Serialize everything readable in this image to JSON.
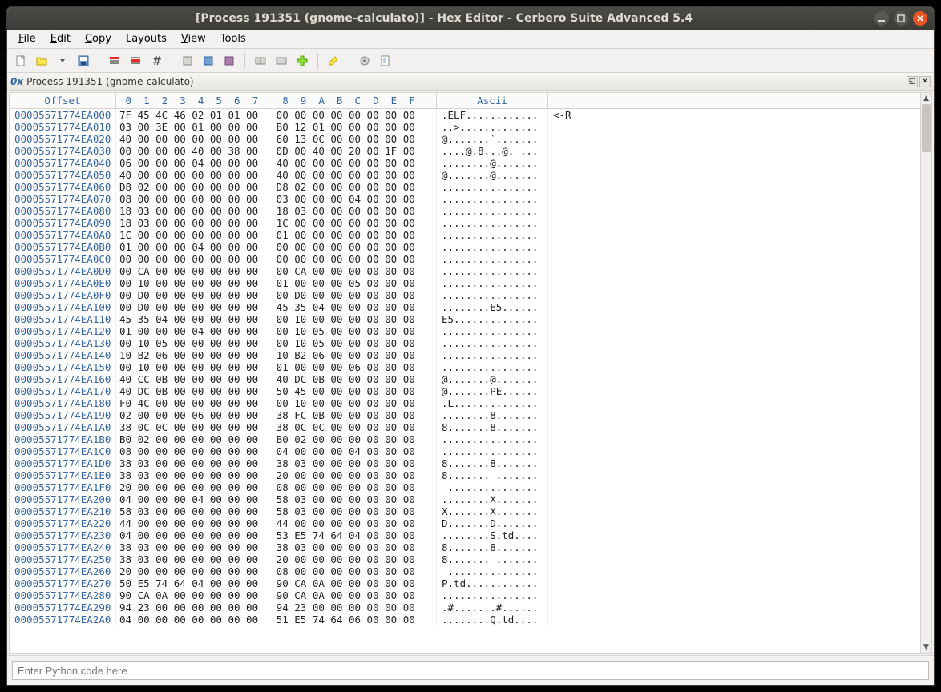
{
  "window": {
    "title": "[Process 191351 (gnome-calculato)] - Hex Editor - Cerbero Suite Advanced 5.4"
  },
  "menu": {
    "file": "File",
    "edit": "Edit",
    "copy": "Copy",
    "layouts": "Layouts",
    "view": "View",
    "tools": "Tools"
  },
  "breadcrumb": {
    "prefix": "0x",
    "text": "Process 191351 (gnome-calculato)"
  },
  "hex_header": {
    "offset": "Offset",
    "cols": " 0  1  2  3  4  5  6  7    8  9  A  B  C  D  E  F",
    "ascii": "Ascii"
  },
  "hint": "<-R",
  "rows": [
    {
      "o": "00005571774EA000",
      "h": "7F 45 4C 46 02 01 01 00   00 00 00 00 00 00 00 00",
      "a": ".ELF............"
    },
    {
      "o": "00005571774EA010",
      "h": "03 00 3E 00 01 00 00 00   B0 12 01 00 00 00 00 00",
      "a": "..>............."
    },
    {
      "o": "00005571774EA020",
      "h": "40 00 00 00 00 00 00 00   60 13 0C 00 00 00 00 00",
      "a": "@.......`......."
    },
    {
      "o": "00005571774EA030",
      "h": "00 00 00 00 40 00 38 00   0D 00 40 00 20 00 1F 00",
      "a": "....@.8...@. ..."
    },
    {
      "o": "00005571774EA040",
      "h": "06 00 00 00 04 00 00 00   40 00 00 00 00 00 00 00",
      "a": "........@......."
    },
    {
      "o": "00005571774EA050",
      "h": "40 00 00 00 00 00 00 00   40 00 00 00 00 00 00 00",
      "a": "@.......@......."
    },
    {
      "o": "00005571774EA060",
      "h": "D8 02 00 00 00 00 00 00   D8 02 00 00 00 00 00 00",
      "a": "................"
    },
    {
      "o": "00005571774EA070",
      "h": "08 00 00 00 00 00 00 00   03 00 00 00 04 00 00 00",
      "a": "................"
    },
    {
      "o": "00005571774EA080",
      "h": "18 03 00 00 00 00 00 00   18 03 00 00 00 00 00 00",
      "a": "................"
    },
    {
      "o": "00005571774EA090",
      "h": "18 03 00 00 00 00 00 00   1C 00 00 00 00 00 00 00",
      "a": "................"
    },
    {
      "o": "00005571774EA0A0",
      "h": "1C 00 00 00 00 00 00 00   01 00 00 00 00 00 00 00",
      "a": "................"
    },
    {
      "o": "00005571774EA0B0",
      "h": "01 00 00 00 04 00 00 00   00 00 00 00 00 00 00 00",
      "a": "................"
    },
    {
      "o": "00005571774EA0C0",
      "h": "00 00 00 00 00 00 00 00   00 00 00 00 00 00 00 00",
      "a": "................"
    },
    {
      "o": "00005571774EA0D0",
      "h": "00 CA 00 00 00 00 00 00   00 CA 00 00 00 00 00 00",
      "a": "................"
    },
    {
      "o": "00005571774EA0E0",
      "h": "00 10 00 00 00 00 00 00   01 00 00 00 05 00 00 00",
      "a": "................"
    },
    {
      "o": "00005571774EA0F0",
      "h": "00 D0 00 00 00 00 00 00   00 D0 00 00 00 00 00 00",
      "a": "................"
    },
    {
      "o": "00005571774EA100",
      "h": "00 D0 00 00 00 00 00 00   45 35 04 00 00 00 00 00",
      "a": "........E5......"
    },
    {
      "o": "00005571774EA110",
      "h": "45 35 04 00 00 00 00 00   00 10 00 00 00 00 00 00",
      "a": "E5.............."
    },
    {
      "o": "00005571774EA120",
      "h": "01 00 00 00 04 00 00 00   00 10 05 00 00 00 00 00",
      "a": "................"
    },
    {
      "o": "00005571774EA130",
      "h": "00 10 05 00 00 00 00 00   00 10 05 00 00 00 00 00",
      "a": "................"
    },
    {
      "o": "00005571774EA140",
      "h": "10 B2 06 00 00 00 00 00   10 B2 06 00 00 00 00 00",
      "a": "................"
    },
    {
      "o": "00005571774EA150",
      "h": "00 10 00 00 00 00 00 00   01 00 00 00 06 00 00 00",
      "a": "................"
    },
    {
      "o": "00005571774EA160",
      "h": "40 CC 0B 00 00 00 00 00   40 DC 0B 00 00 00 00 00",
      "a": "@.......@......."
    },
    {
      "o": "00005571774EA170",
      "h": "40 DC 0B 00 00 00 00 00   50 45 00 00 00 00 00 00",
      "a": "@.......PE......"
    },
    {
      "o": "00005571774EA180",
      "h": "F0 4C 00 00 00 00 00 00   00 10 00 00 00 00 00 00",
      "a": ".L.............."
    },
    {
      "o": "00005571774EA190",
      "h": "02 00 00 00 06 00 00 00   38 FC 0B 00 00 00 00 00",
      "a": "........8......."
    },
    {
      "o": "00005571774EA1A0",
      "h": "38 0C 0C 00 00 00 00 00   38 0C 0C 00 00 00 00 00",
      "a": "8.......8......."
    },
    {
      "o": "00005571774EA1B0",
      "h": "B0 02 00 00 00 00 00 00   B0 02 00 00 00 00 00 00",
      "a": "................"
    },
    {
      "o": "00005571774EA1C0",
      "h": "08 00 00 00 00 00 00 00   04 00 00 00 04 00 00 00",
      "a": "................"
    },
    {
      "o": "00005571774EA1D0",
      "h": "38 03 00 00 00 00 00 00   38 03 00 00 00 00 00 00",
      "a": "8.......8......."
    },
    {
      "o": "00005571774EA1E0",
      "h": "38 03 00 00 00 00 00 00   20 00 00 00 00 00 00 00",
      "a": "8....... ......."
    },
    {
      "o": "00005571774EA1F0",
      "h": "20 00 00 00 00 00 00 00   08 00 00 00 00 00 00 00",
      "a": " ..............."
    },
    {
      "o": "00005571774EA200",
      "h": "04 00 00 00 04 00 00 00   58 03 00 00 00 00 00 00",
      "a": "........X......."
    },
    {
      "o": "00005571774EA210",
      "h": "58 03 00 00 00 00 00 00   58 03 00 00 00 00 00 00",
      "a": "X.......X......."
    },
    {
      "o": "00005571774EA220",
      "h": "44 00 00 00 00 00 00 00   44 00 00 00 00 00 00 00",
      "a": "D.......D......."
    },
    {
      "o": "00005571774EA230",
      "h": "04 00 00 00 00 00 00 00   53 E5 74 64 04 00 00 00",
      "a": "........S.td...."
    },
    {
      "o": "00005571774EA240",
      "h": "38 03 00 00 00 00 00 00   38 03 00 00 00 00 00 00",
      "a": "8.......8......."
    },
    {
      "o": "00005571774EA250",
      "h": "38 03 00 00 00 00 00 00   20 00 00 00 00 00 00 00",
      "a": "8....... ......."
    },
    {
      "o": "00005571774EA260",
      "h": "20 00 00 00 00 00 00 00   08 00 00 00 00 00 00 00",
      "a": " ..............."
    },
    {
      "o": "00005571774EA270",
      "h": "50 E5 74 64 04 00 00 00   90 CA 0A 00 00 00 00 00",
      "a": "P.td............"
    },
    {
      "o": "00005571774EA280",
      "h": "90 CA 0A 00 00 00 00 00   90 CA 0A 00 00 00 00 00",
      "a": "................"
    },
    {
      "o": "00005571774EA290",
      "h": "94 23 00 00 00 00 00 00   94 23 00 00 00 00 00 00",
      "a": ".#.......#......"
    },
    {
      "o": "00005571774EA2A0",
      "h": "04 00 00 00 00 00 00 00   51 E5 74 64 06 00 00 00",
      "a": "........Q.td...."
    }
  ],
  "python": {
    "placeholder": "Enter Python code here"
  }
}
